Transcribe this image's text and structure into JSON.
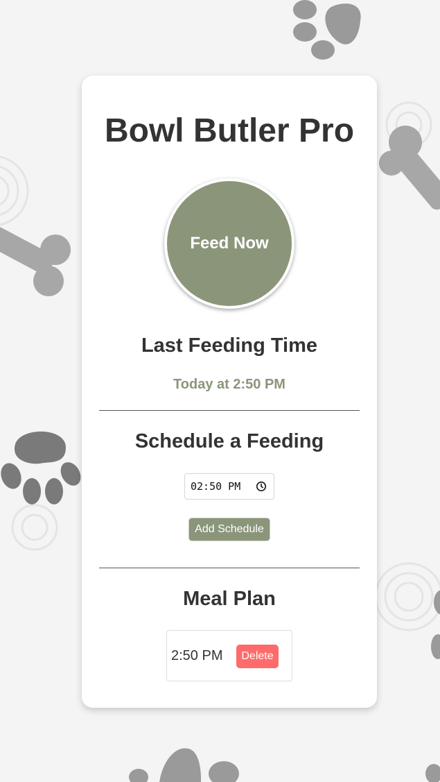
{
  "app": {
    "title": "Bowl Butler Pro",
    "feed_now_label": "Feed Now"
  },
  "last_feeding": {
    "heading": "Last Feeding Time",
    "value": "Today at 2:50 PM"
  },
  "schedule": {
    "heading": "Schedule a Feeding",
    "time_value": "02:50 PM",
    "add_label": "Add Schedule"
  },
  "meal_plan": {
    "heading": "Meal Plan",
    "items": [
      {
        "time": "2:50 PM",
        "delete_label": "Delete"
      }
    ]
  },
  "colors": {
    "accent": "#8a957a",
    "danger": "#ff6b6b",
    "background": "#f4f4f4",
    "card": "#ffffff",
    "text": "#333333"
  },
  "background_icons": [
    "paw-print-icon",
    "dog-bone-icon",
    "ripple-pattern"
  ]
}
